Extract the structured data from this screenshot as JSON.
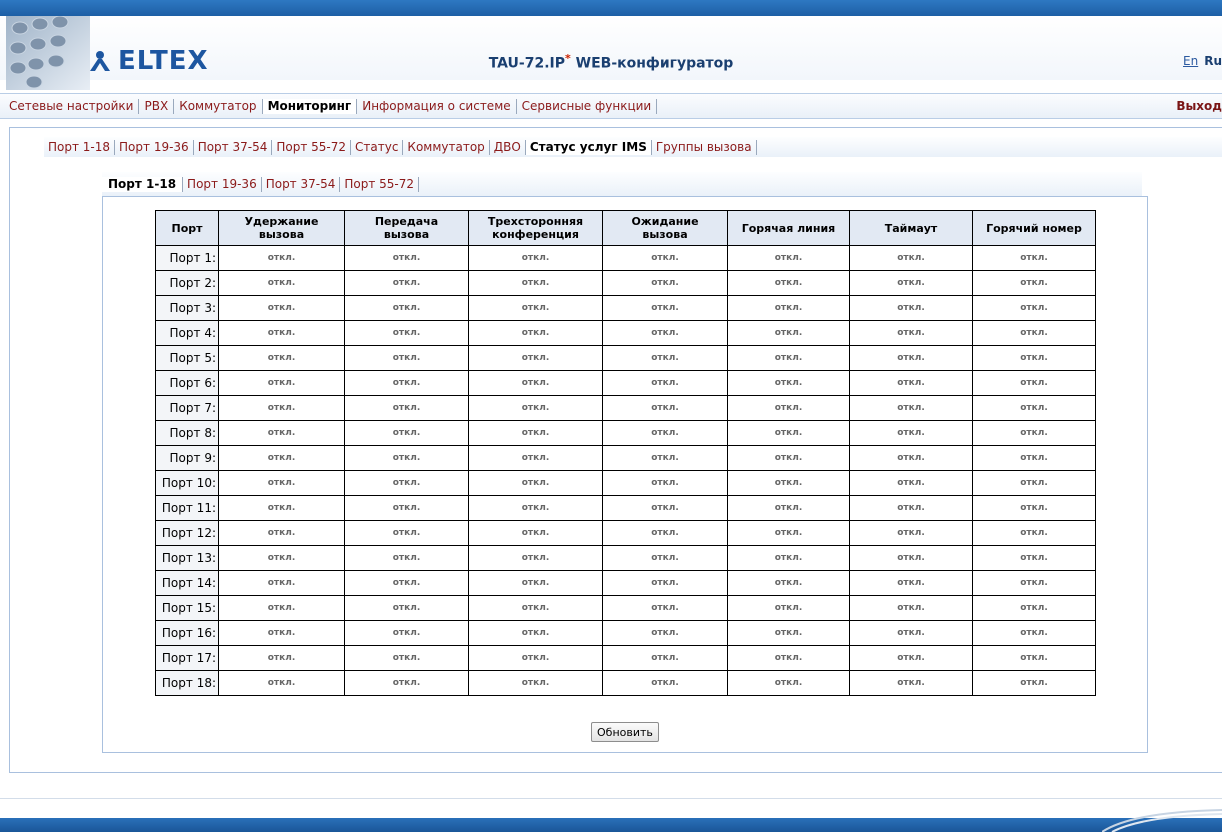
{
  "header": {
    "logo_text": "ELTEX",
    "title": "TAU-72.IP",
    "title_mark": "*",
    "title_suffix": " WEB-конфигуратор",
    "lang_en": "En",
    "lang_ru": "Ru"
  },
  "main_nav": {
    "items": [
      "Сетевые настройки",
      "PBX",
      "Коммутатор",
      "Мониторинг",
      "Информация о системе",
      "Сервисные функции"
    ],
    "active": "Мониторинг",
    "logout": "Выход"
  },
  "sub_nav": {
    "items": [
      "Порт 1-18",
      "Порт 19-36",
      "Порт 37-54",
      "Порт 55-72",
      "Статус",
      "Коммутатор",
      "ДВО",
      "Статус услуг IMS",
      "Группы вызова"
    ],
    "active": "Статус услуг IMS"
  },
  "port_tabs": {
    "items": [
      "Порт 1-18",
      "Порт 19-36",
      "Порт 37-54",
      "Порт 55-72"
    ],
    "active": "Порт 1-18"
  },
  "table": {
    "headers": [
      {
        "line1": "Порт",
        "line2": ""
      },
      {
        "line1": "Удержание",
        "line2": "вызова"
      },
      {
        "line1": "Передача",
        "line2": "вызова"
      },
      {
        "line1": "Трехсторонняя",
        "line2": "конференция"
      },
      {
        "line1": "Ожидание",
        "line2": "вызова"
      },
      {
        "line1": "Горячая линия",
        "line2": ""
      },
      {
        "line1": "Таймаут",
        "line2": ""
      },
      {
        "line1": "Горячий номер",
        "line2": ""
      }
    ],
    "rows": [
      {
        "port": "Порт 1:",
        "values": [
          "откл.",
          "откл.",
          "откл.",
          "откл.",
          "откл.",
          "откл.",
          "откл."
        ]
      },
      {
        "port": "Порт 2:",
        "values": [
          "откл.",
          "откл.",
          "откл.",
          "откл.",
          "откл.",
          "откл.",
          "откл."
        ]
      },
      {
        "port": "Порт 3:",
        "values": [
          "откл.",
          "откл.",
          "откл.",
          "откл.",
          "откл.",
          "откл.",
          "откл."
        ]
      },
      {
        "port": "Порт 4:",
        "values": [
          "откл.",
          "откл.",
          "откл.",
          "откл.",
          "откл.",
          "откл.",
          "откл."
        ]
      },
      {
        "port": "Порт 5:",
        "values": [
          "откл.",
          "откл.",
          "откл.",
          "откл.",
          "откл.",
          "откл.",
          "откл."
        ]
      },
      {
        "port": "Порт 6:",
        "values": [
          "откл.",
          "откл.",
          "откл.",
          "откл.",
          "откл.",
          "откл.",
          "откл."
        ]
      },
      {
        "port": "Порт 7:",
        "values": [
          "откл.",
          "откл.",
          "откл.",
          "откл.",
          "откл.",
          "откл.",
          "откл."
        ]
      },
      {
        "port": "Порт 8:",
        "values": [
          "откл.",
          "откл.",
          "откл.",
          "откл.",
          "откл.",
          "откл.",
          "откл."
        ]
      },
      {
        "port": "Порт 9:",
        "values": [
          "откл.",
          "откл.",
          "откл.",
          "откл.",
          "откл.",
          "откл.",
          "откл."
        ]
      },
      {
        "port": "Порт 10:",
        "values": [
          "откл.",
          "откл.",
          "откл.",
          "откл.",
          "откл.",
          "откл.",
          "откл."
        ]
      },
      {
        "port": "Порт 11:",
        "values": [
          "откл.",
          "откл.",
          "откл.",
          "откл.",
          "откл.",
          "откл.",
          "откл."
        ]
      },
      {
        "port": "Порт 12:",
        "values": [
          "откл.",
          "откл.",
          "откл.",
          "откл.",
          "откл.",
          "откл.",
          "откл."
        ]
      },
      {
        "port": "Порт 13:",
        "values": [
          "откл.",
          "откл.",
          "откл.",
          "откл.",
          "откл.",
          "откл.",
          "откл."
        ]
      },
      {
        "port": "Порт 14:",
        "values": [
          "откл.",
          "откл.",
          "откл.",
          "откл.",
          "откл.",
          "откл.",
          "откл."
        ]
      },
      {
        "port": "Порт 15:",
        "values": [
          "откл.",
          "откл.",
          "откл.",
          "откл.",
          "откл.",
          "откл.",
          "откл."
        ]
      },
      {
        "port": "Порт 16:",
        "values": [
          "откл.",
          "откл.",
          "откл.",
          "откл.",
          "откл.",
          "откл.",
          "откл."
        ]
      },
      {
        "port": "Порт 17:",
        "values": [
          "откл.",
          "откл.",
          "откл.",
          "откл.",
          "откл.",
          "откл.",
          "откл."
        ]
      },
      {
        "port": "Порт 18:",
        "values": [
          "откл.",
          "откл.",
          "откл.",
          "откл.",
          "откл.",
          "откл.",
          "откл."
        ]
      }
    ]
  },
  "refresh_label": "Обновить",
  "colors": {
    "header_blue": "#1d5fa5",
    "link_red": "#8b1a1a",
    "logo_blue": "#1d56a0",
    "frame_border": "#a9c0de",
    "table_header_bg": "#e2e9f3"
  },
  "icons": {
    "corner_image": "keypad-photo-icon",
    "logo_mark": "eltex-logo-icon"
  }
}
